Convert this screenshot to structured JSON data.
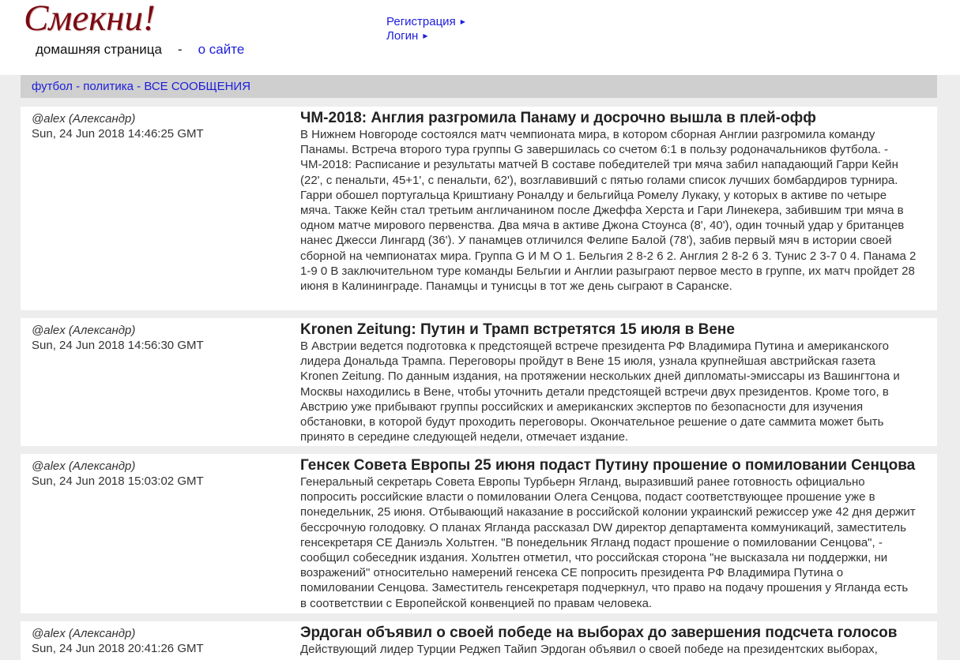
{
  "site": {
    "logo": "Смекни!",
    "nav_home": "домашняя страница",
    "nav_sep": "-",
    "nav_about": "о сайте",
    "register": "Регистрация",
    "login": "Логин",
    "arrow": "▶"
  },
  "categories": {
    "football": "футбол",
    "politics": "политика",
    "all": "ВСЕ СООБЩЕНИЯ",
    "dash": " - "
  },
  "posts": [
    {
      "author": "@alex (Александр)",
      "date": "Sun, 24 Jun 2018 14:46:25 GMT",
      "title": "ЧМ-2018: Англия разгромила Панаму и досрочно вышла в плей-офф",
      "body": "В Нижнем Новгороде состоялся матч чемпионата мира, в котором сборная Англии разгромила команду Панамы. Встреча второго тура группы G завершилась со счетом 6:1 в пользу родоначальников футбола. - ЧМ-2018: Расписание и результаты матчей В составе победителей три мяча забил нападающий Гарри Кейн (22', с пенальти, 45+1', с пенальти, 62'), возглавивший с пятью голами список лучших бомбардиров турнира. Гарри обошел португальца Криштиану Роналду и бельгийца Ромелу Лукаку, у которых в активе по четыре мяча. Также Кейн стал третьим англичанином после Джеффа Херста и Гари Линекера, забившим три мяча в одном матче мирового первенства. Два мяча в активе Джона Стоунса (8', 40'), один точный удар у британцев нанес Джесси Лингард (36'). У панамцев отличился Фелипе Балой (78'), забив первый мяч в истории своей сборной на чемпионатах мира. Группа G И М О 1. Бельгия 2 8-2 6 2. Англия 2 8-2 6 3. Тунис 2 3-7 0 4. Панама 2 1-9 0 В заключительном туре команды Бельгии и Англии разыграют первое место в группе, их матч пройдет 28 июня в Калининграде. Панамцы и тунисцы в тот же день сыграют в Саранске."
    },
    {
      "author": "@alex (Александр)",
      "date": "Sun, 24 Jun 2018 14:56:30 GMT",
      "title": "Kronen Zeitung: Путин и Трамп встретятся 15 июля в Вене",
      "body": "В Австрии ведется подготовка к предстоящей встрече президента РФ Владимира Путина и американского лидера Дональда Трампа. Переговоры пройдут в Вене 15 июля, узнала крупнейшая австрийская газета Kronen Zeitung. По данным издания, на протяжении нескольких дней дипломаты-эмиссары из Вашингтона и Москвы находились в Вене, чтобы уточнить детали предстоящей встречи двух президентов. Кроме того, в Австрию уже прибывают группы российских и американских экспертов по безопасности для изучения обстановки, в которой будут проходить переговоры. Окончательное решение о дате саммита может быть принято в середине следующей недели, отмечает издание."
    },
    {
      "author": "@alex (Александр)",
      "date": "Sun, 24 Jun 2018 15:03:02 GMT",
      "title": "Генсек Совета Европы 25 июня подаст Путину прошение о помиловании Сенцова",
      "body": "Генеральный секретарь Совета Европы Турбьерн Ягланд, выразивший ранее готовность официально попросить российские власти о помиловании Олега Сенцова, подаст соответствующее прошение уже в понедельник, 25 июня. Отбывающий наказание в российской колонии украинский режиссер уже 42 дня держит бессрочную голодовку. О планах Ягланда рассказал DW директор департамента коммуникаций, заместитель генсекретаря СЕ Даниэль Хольтген. \"В понедельник Ягланд подаст прошение о помиловании Сенцова\", - сообщил собеседник издания. Хольтген отметил, что российская сторона \"не высказала ни поддержки, ни возражений\" относительно намерений генсека СЕ попросить президента РФ Владимира Путина о помиловании Сенцова. Заместитель генсекретаря подчеркнул, что право на подачу прошения у Ягланда есть в соответствии с Европейской конвенцией по правам человека."
    },
    {
      "author": "@alex (Александр)",
      "date": "Sun, 24 Jun 2018 20:41:26 GMT",
      "title": "Эрдоган объявил о своей победе на выборах до завершения подсчета голосов",
      "body": "Действующий лидер Турции Реджеп Тайип Эрдоган объявил о своей победе на президентских выборах,"
    }
  ]
}
